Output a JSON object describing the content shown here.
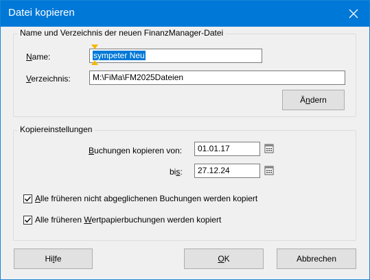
{
  "window": {
    "title": "Datei kopieren",
    "close_icon": "close-icon"
  },
  "group_file": {
    "title": "Name und Verzeichnis der neuen FinanzManager-Datei",
    "name_label_key": "N",
    "name_label_rest": "ame:",
    "name_value": "sympeter Neu",
    "dir_label_key": "V",
    "dir_label_rest": "erzeichnis:",
    "dir_value": "M:\\FiMa\\FM2025Dateien",
    "change_btn_pre": "Ä",
    "change_btn_key": "n",
    "change_btn_post": "dern"
  },
  "group_copy": {
    "title": "Kopiereinstellungen",
    "from_label_key": "B",
    "from_label_rest": "uchungen kopieren von:",
    "from_value": "01.01.17",
    "to_label_pre": "bi",
    "to_label_key": "s",
    "to_label_post": ":",
    "to_value": "27.12.24",
    "calendar_icon": "calendar-icon",
    "check1": {
      "checked": true,
      "key": "A",
      "rest": "lle früheren nicht abgeglichenen Buchungen werden kopiert"
    },
    "check2": {
      "checked": true,
      "pre": "Alle früheren ",
      "key": "W",
      "post": "ertpapierbuchungen werden kopiert"
    }
  },
  "footer": {
    "help_pre": "Hi",
    "help_key": "l",
    "help_post": "fe",
    "ok_key": "O",
    "ok_post": "K",
    "cancel_label": "Abbrechen"
  },
  "colors": {
    "titlebar": "#0078d7",
    "selection": "#0078d7",
    "text_cursor_marker": "#f5b800"
  }
}
